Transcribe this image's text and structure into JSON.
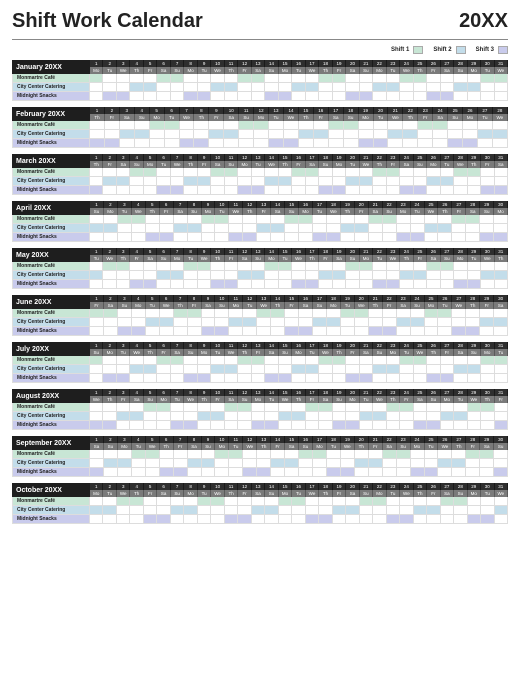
{
  "title": "Shift Work Calendar",
  "year": "20XX",
  "legend": {
    "shift1": "Shift 1",
    "shift2": "Shift 2",
    "shift3": "Shift 3"
  },
  "colors": {
    "shift1": "#c8e6d5",
    "shift2": "#c3ddea",
    "shift3": "#c9cbec"
  },
  "dow_labels": [
    "Mo",
    "Tu",
    "We",
    "Th",
    "Fr",
    "Sa",
    "Su"
  ],
  "row_labels": [
    "Monmartre Café",
    "City Center Catering",
    "Midnight Snacks"
  ],
  "months": [
    {
      "name": "January 20XX",
      "days": 31,
      "start": 0
    },
    {
      "name": "February 20XX",
      "days": 28,
      "start": 3
    },
    {
      "name": "March 20XX",
      "days": 31,
      "start": 3
    },
    {
      "name": "April 20XX",
      "days": 30,
      "start": 6
    },
    {
      "name": "May 20XX",
      "days": 31,
      "start": 1
    },
    {
      "name": "June 20XX",
      "days": 30,
      "start": 4
    },
    {
      "name": "July 20XX",
      "days": 31,
      "start": 6
    },
    {
      "name": "August 20XX",
      "days": 31,
      "start": 2
    },
    {
      "name": "September 20XX",
      "days": 30,
      "start": 5
    },
    {
      "name": "October 20XX",
      "days": 31,
      "start": 0
    }
  ],
  "shift_pattern_comment": "Each business row is filled with a repeating 4-on / 2-off colored pattern using its row color; offsets stagger across months.",
  "chart_data": {
    "type": "table",
    "title": "Shift Work Calendar 20XX",
    "rows": [
      "Monmartre Café",
      "City Center Catering",
      "Midnight Snacks"
    ],
    "legend": [
      "Shift 1",
      "Shift 2",
      "Shift 3"
    ],
    "pattern": "Indicative staggered shift blocks per row per day; colored cells denote scheduled shift."
  }
}
